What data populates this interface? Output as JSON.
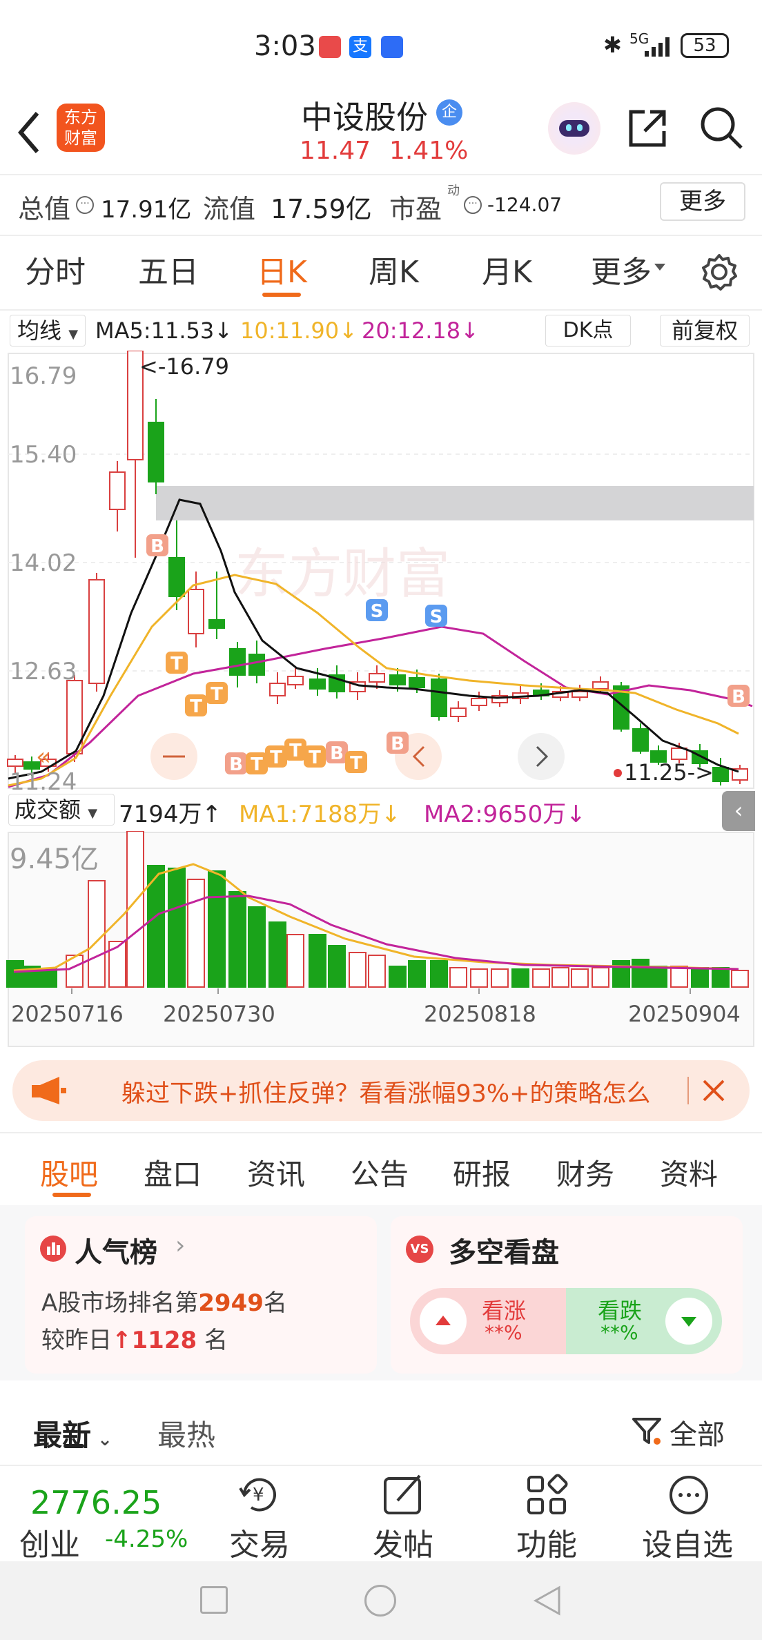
{
  "status": {
    "time": "3:03",
    "network": "5G",
    "battery": "53"
  },
  "header": {
    "logo_line1": "东方",
    "logo_line2": "财富",
    "stock_name": "中设股份",
    "badge": "企",
    "price": "11.47",
    "change_pct": "1.41%"
  },
  "summary": {
    "total_label": "总值",
    "total_value": "17.91亿",
    "float_label": "流值",
    "float_value": "17.59亿",
    "pe_label": "市盈",
    "pe_sup": "动",
    "pe_value": "-124.07",
    "more_button": "更多"
  },
  "period_tabs": {
    "items": [
      "分时",
      "五日",
      "日K",
      "周K",
      "月K",
      "更多"
    ],
    "active": "日K"
  },
  "ma_bar": {
    "selector": "均线",
    "ma5": "MA5:11.53",
    "ma10": "10:11.90",
    "ma20": "20:12.18",
    "dk_button": "DK点",
    "adjust_button": "前复权"
  },
  "kline": {
    "y_labels": [
      "16.79",
      "15.40",
      "14.02",
      "12.63",
      "11.24"
    ],
    "max_label": "<-16.79",
    "min_label": "11.25->",
    "watermark": "东方财富",
    "markers": [
      "B",
      "T",
      "S"
    ]
  },
  "volume": {
    "selector": "成交额",
    "value": "7194万",
    "ma1": "MA1:7188万",
    "ma2": "MA2:9650万",
    "y_label": "9.45亿",
    "dates": [
      "20250716",
      "20250730",
      "20250818",
      "20250904"
    ]
  },
  "banner": {
    "text": "躲过下跌+抓住反弹？看看涨幅93%+的策略怎么"
  },
  "section_tabs": {
    "items": [
      "股吧",
      "盘口",
      "资讯",
      "公告",
      "研报",
      "财务",
      "资料"
    ],
    "active": "股吧"
  },
  "popularity": {
    "title": "人气榜",
    "line1_prefix": "A股市场排名第",
    "rank": "2949",
    "line1_suffix": "名",
    "line2_prefix": "较昨日",
    "change": "1128",
    "line2_suffix": "名"
  },
  "bull_bear": {
    "icon_text": "VS",
    "title": "多空看盘",
    "bull_label": "看涨",
    "bull_value": "**%",
    "bear_label": "看跌",
    "bear_value": "**%"
  },
  "feed_tabs": {
    "latest": "最新",
    "hot": "最热",
    "filter": "全部"
  },
  "bottom_bar": {
    "index_value": "2776.25",
    "index_name": "创业",
    "index_change": "-4.25%",
    "trade": "交易",
    "post": "发帖",
    "features": "功能",
    "watchlist": "设自选"
  },
  "colors": {
    "accent": "#f06a1a",
    "up": "#e23b3b",
    "down": "#1aa31a",
    "ma5": "#111111",
    "ma10": "#f0b429",
    "ma20": "#c2249a"
  }
}
